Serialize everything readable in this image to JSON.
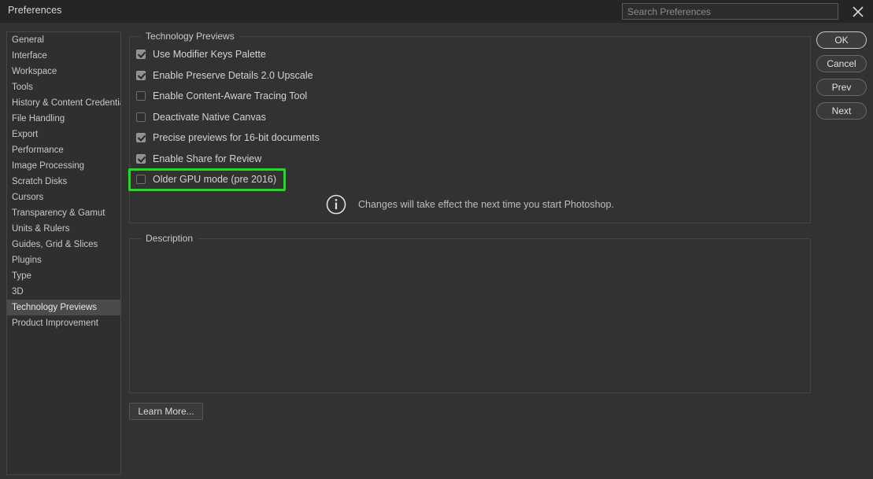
{
  "window": {
    "title": "Preferences",
    "close_icon": "close-icon"
  },
  "search": {
    "placeholder": "Search Preferences",
    "value": ""
  },
  "sidebar": {
    "items": [
      {
        "label": "General",
        "selected": false
      },
      {
        "label": "Interface",
        "selected": false
      },
      {
        "label": "Workspace",
        "selected": false
      },
      {
        "label": "Tools",
        "selected": false
      },
      {
        "label": "History & Content Credentials",
        "selected": false
      },
      {
        "label": "File Handling",
        "selected": false
      },
      {
        "label": "Export",
        "selected": false
      },
      {
        "label": "Performance",
        "selected": false
      },
      {
        "label": "Image Processing",
        "selected": false
      },
      {
        "label": "Scratch Disks",
        "selected": false
      },
      {
        "label": "Cursors",
        "selected": false
      },
      {
        "label": "Transparency & Gamut",
        "selected": false
      },
      {
        "label": "Units & Rulers",
        "selected": false
      },
      {
        "label": "Guides, Grid & Slices",
        "selected": false
      },
      {
        "label": "Plugins",
        "selected": false
      },
      {
        "label": "Type",
        "selected": false
      },
      {
        "label": "3D",
        "selected": false
      },
      {
        "label": "Technology Previews",
        "selected": true
      },
      {
        "label": "Product Improvement",
        "selected": false
      }
    ]
  },
  "tech_previews": {
    "group_title": "Technology Previews",
    "options": [
      {
        "label": "Use Modifier Keys Palette",
        "checked": true,
        "highlighted": false
      },
      {
        "label": "Enable Preserve Details 2.0 Upscale",
        "checked": true,
        "highlighted": false
      },
      {
        "label": "Enable Content-Aware Tracing Tool",
        "checked": false,
        "highlighted": false
      },
      {
        "label": "Deactivate Native Canvas",
        "checked": false,
        "highlighted": false
      },
      {
        "label": "Precise previews for 16-bit documents",
        "checked": true,
        "highlighted": false
      },
      {
        "label": "Enable Share for Review",
        "checked": true,
        "highlighted": false
      },
      {
        "label": "Older GPU mode (pre 2016)",
        "checked": false,
        "highlighted": true
      }
    ],
    "note": {
      "icon": "info-icon",
      "text": "Changes will take effect the next time you start Photoshop."
    }
  },
  "description": {
    "group_title": "Description",
    "body": ""
  },
  "learn_more": {
    "label": "Learn More..."
  },
  "buttons": [
    {
      "label": "OK",
      "primary": true
    },
    {
      "label": "Cancel",
      "primary": false
    },
    {
      "label": "Prev",
      "primary": false
    },
    {
      "label": "Next",
      "primary": false
    }
  ],
  "colors": {
    "highlight": "#19e01c",
    "window_bg": "#323232",
    "titlebar_bg": "#252525",
    "selection_bg": "#4b4b4b"
  }
}
